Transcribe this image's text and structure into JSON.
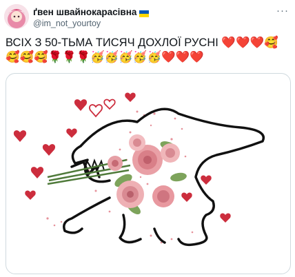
{
  "author": {
    "display_name": "ґвен швайнокарасівна",
    "handle": "@im_not_yourtoy",
    "flag": "ukraine-flag"
  },
  "more_label": "···",
  "tweet_text": "ВСІХ З 50-ТЬМА ТИСЯЧ ДОХЛОЇ РУСНІ",
  "emoji_line1": "❤️❤️❤️🥰",
  "emoji_line2": "🥰🥰🥰🌹🌹🌹🥳🥳🥳🥳🥳❤️❤️❤️",
  "media": {
    "description_icon": "dinosaur-with-roses-drawing"
  },
  "colors": {
    "heart": "#e0245e",
    "ukraine_blue": "#0057b7",
    "ukraine_yellow": "#ffd700",
    "border": "#cfd9de",
    "secondary_text": "#536471"
  }
}
